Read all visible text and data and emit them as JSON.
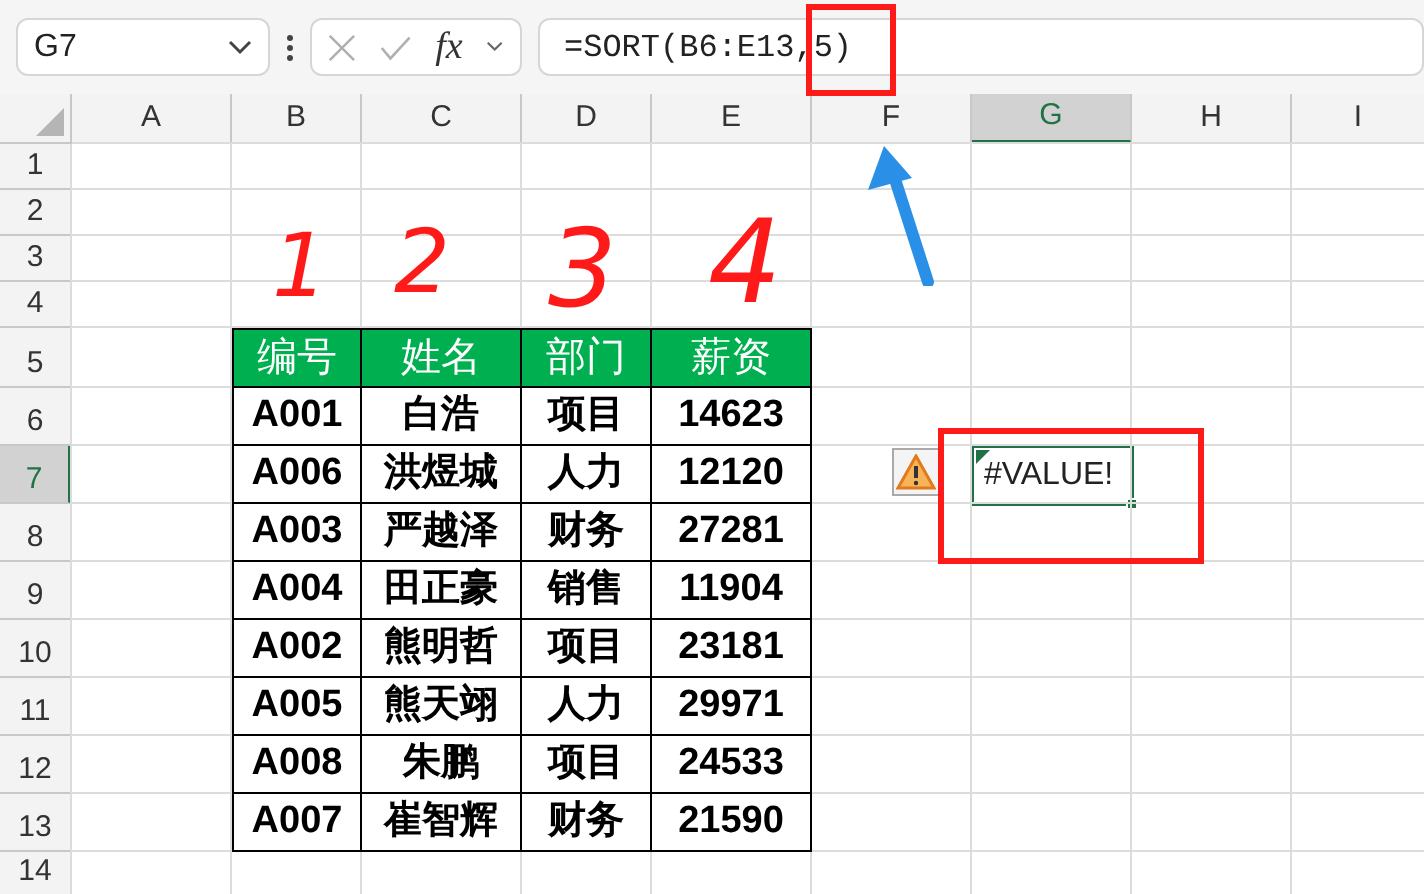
{
  "name_box": "G7",
  "function_label": "fx",
  "formula": "=SORT(B6:E13,5)",
  "columns": [
    {
      "label": "A",
      "selected": false
    },
    {
      "label": "B",
      "selected": false
    },
    {
      "label": "C",
      "selected": false
    },
    {
      "label": "D",
      "selected": false
    },
    {
      "label": "E",
      "selected": false
    },
    {
      "label": "F",
      "selected": false
    },
    {
      "label": "G",
      "selected": true
    },
    {
      "label": "H",
      "selected": false
    },
    {
      "label": "I",
      "selected": false
    }
  ],
  "rows": [
    {
      "label": "1",
      "selected": false
    },
    {
      "label": "2",
      "selected": false
    },
    {
      "label": "3",
      "selected": false
    },
    {
      "label": "4",
      "selected": false
    },
    {
      "label": "5",
      "selected": false
    },
    {
      "label": "6",
      "selected": false
    },
    {
      "label": "7",
      "selected": true
    },
    {
      "label": "8",
      "selected": false
    },
    {
      "label": "9",
      "selected": false
    },
    {
      "label": "10",
      "selected": false
    },
    {
      "label": "11",
      "selected": false
    },
    {
      "label": "12",
      "selected": false
    },
    {
      "label": "13",
      "selected": false
    },
    {
      "label": "14",
      "selected": false
    }
  ],
  "table": {
    "header": [
      "编号",
      "姓名",
      "部门",
      "薪资"
    ],
    "rows": [
      [
        "A001",
        "白浩",
        "项目",
        "14623"
      ],
      [
        "A006",
        "洪煜城",
        "人力",
        "12120"
      ],
      [
        "A003",
        "严越泽",
        "财务",
        "27281"
      ],
      [
        "A004",
        "田正豪",
        "销售",
        "11904"
      ],
      [
        "A002",
        "熊明哲",
        "项目",
        "23181"
      ],
      [
        "A005",
        "熊天翊",
        "人力",
        "29971"
      ],
      [
        "A008",
        "朱鹏",
        "项目",
        "24533"
      ],
      [
        "A007",
        "崔智辉",
        "财务",
        "21590"
      ]
    ]
  },
  "active_cell": {
    "value": "#VALUE!"
  },
  "annotations": {
    "numbers": [
      "1",
      "2",
      "3",
      "4"
    ]
  }
}
